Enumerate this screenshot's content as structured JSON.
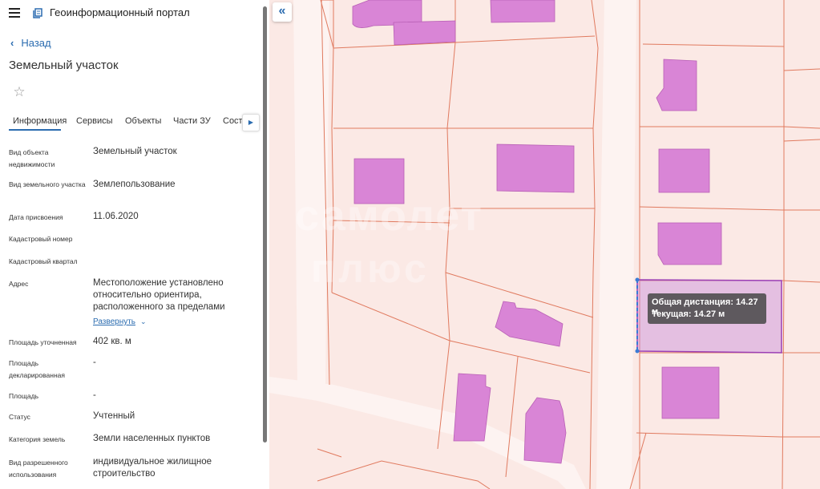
{
  "app": {
    "title": "Геоинформационный портал"
  },
  "nav": {
    "back_label": "Назад"
  },
  "page": {
    "title": "Земельный участок"
  },
  "tabs": [
    {
      "label": "Информация"
    },
    {
      "label": "Сервисы"
    },
    {
      "label": "Объекты"
    },
    {
      "label": "Части ЗУ"
    },
    {
      "label": "Соста"
    }
  ],
  "info": {
    "rows": [
      {
        "label": "Вид объекта недвижимости",
        "value": "Земельный участок"
      },
      {
        "label": "Вид земельного участка",
        "value": "Землепользование"
      },
      {
        "label": "Дата присвоения",
        "value": "11.06.2020"
      },
      {
        "label": "Кадастровый номер",
        "value": ""
      },
      {
        "label": "Кадастровый квартал",
        "value": ""
      },
      {
        "label": "Адрес",
        "value": "Местоположение установлено относительно ориентира, расположенного за пределами"
      },
      {
        "label": "Площадь уточненная",
        "value": "402 кв. м"
      },
      {
        "label": "Площадь декларированная",
        "value": "-"
      },
      {
        "label": "Площадь",
        "value": "-"
      },
      {
        "label": "Статус",
        "value": "Учтенный"
      },
      {
        "label": "Категория земель",
        "value": "Земли населенных пунктов"
      },
      {
        "label": "Вид разрешенного использования",
        "value": "индивидуальное жилищное строительство"
      }
    ],
    "expand_label": "Развернуть"
  },
  "map": {
    "tooltip": {
      "total": "Общая дистанция: 14.27 м",
      "current": "Текущая: 14.27 м"
    },
    "watermark_line1": "самолет",
    "watermark_line2": "плюс"
  },
  "icons": {
    "menu": "menu-icon",
    "logo": "portal-logo-icon",
    "back": "chevron-left-icon",
    "star": "star-icon",
    "tab_scroll": "chevron-right-icon",
    "expand": "chevron-down-icon",
    "collapse": "double-chevron-left-icon"
  },
  "colors": {
    "accent": "#2b6cb0",
    "map_background": "#fbe9e5",
    "parcel_line": "#e07a5f",
    "building": "#d985d6",
    "selection": "#9b3fb5"
  }
}
